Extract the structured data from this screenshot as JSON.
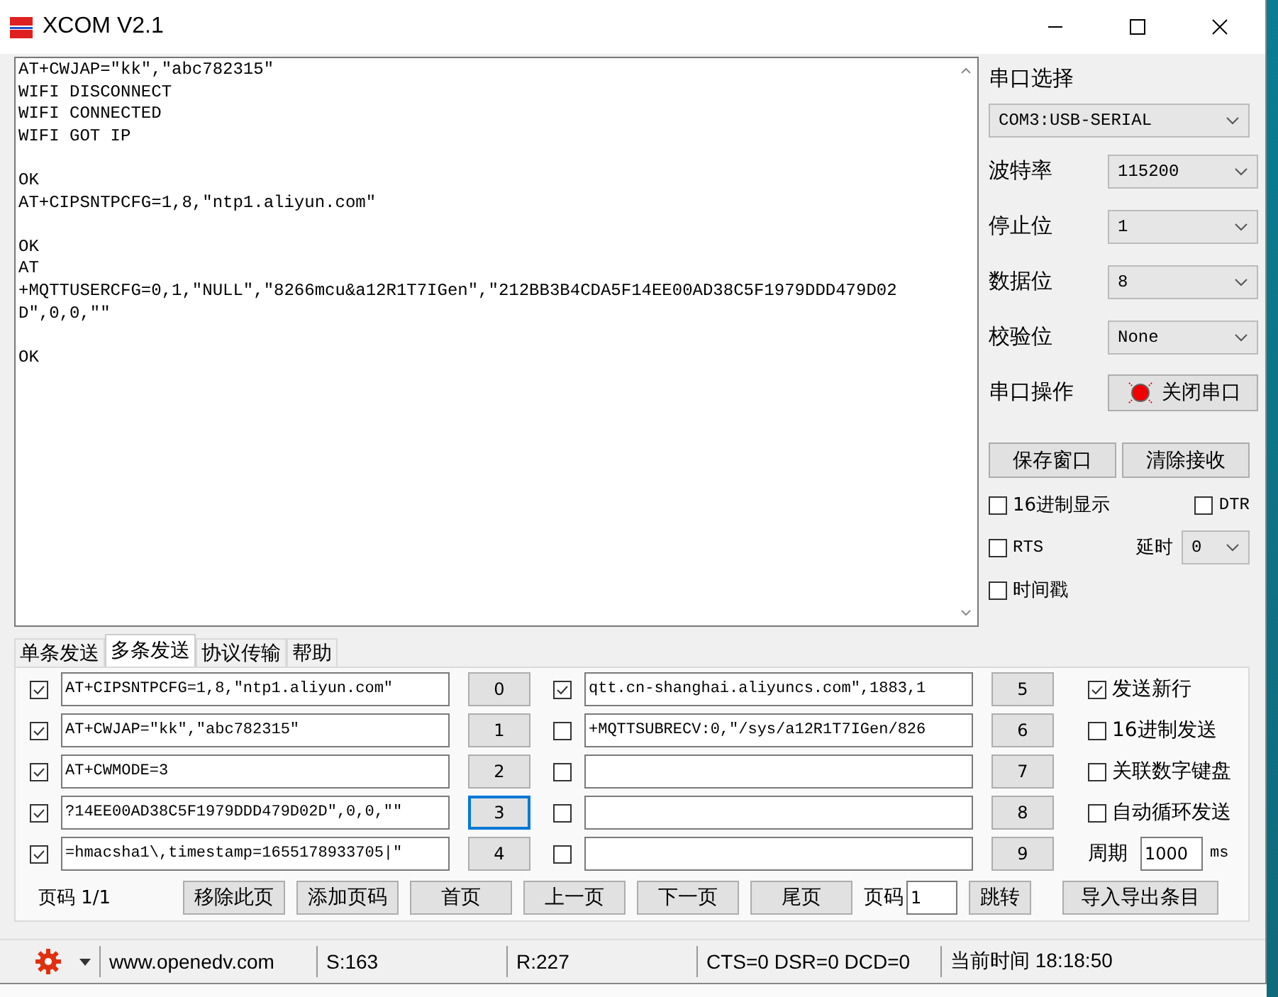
{
  "window": {
    "title": "XCOM V2.1"
  },
  "receive_blocks": [
    [
      "AT+CWJAP=\"kk\",\"abc782315\"",
      "WIFI DISCONNECT",
      "WIFI CONNECTED",
      "WIFI GOT IP"
    ],
    [
      "OK",
      "AT+CIPSNTPCFG=1,8,\"ntp1.aliyun.com\""
    ],
    [
      "OK",
      "AT",
      "+MQTTUSERCFG=0,1,\"NULL\",\"8266mcu&a12R1T7IGen\",\"212BB3B4CDA5F14EE00AD38C5F1979DDD479D02",
      "D\",0,0,\"\""
    ],
    [
      "OK"
    ]
  ],
  "settings": [
    {
      "label": "串口选择",
      "value": "COM3:USB-SERIAL",
      "kind": "stacked"
    },
    {
      "label": "波特率",
      "value": "115200",
      "kind": "inline"
    },
    {
      "label": "停止位",
      "value": "1",
      "kind": "inline"
    },
    {
      "label": "数据位",
      "value": "8",
      "kind": "inline"
    },
    {
      "label": "校验位",
      "value": "None",
      "kind": "inline"
    }
  ],
  "port_operation": {
    "label": "串口操作",
    "button": "关闭串口",
    "open": true
  },
  "panel_buttons": [
    "保存窗口",
    "清除接收"
  ],
  "options": {
    "hex_display": {
      "label": "16进制显示",
      "checked": false
    },
    "dtr": {
      "label": "DTR",
      "checked": false
    },
    "rts": {
      "label": "RTS",
      "checked": false
    },
    "delay": {
      "label": "延时",
      "value": "0"
    },
    "timestamp": {
      "label": "时间戳",
      "checked": false
    }
  },
  "tabs": [
    {
      "label": "单条发送",
      "selected": false
    },
    {
      "label": "多条发送",
      "selected": true
    },
    {
      "label": "协议传输",
      "selected": false
    },
    {
      "label": "帮助",
      "selected": false
    }
  ],
  "send_items": [
    {
      "checked": true,
      "value": "AT+CIPSNTPCFG=1,8,\"ntp1.aliyun.com\"",
      "number": "0",
      "focused": false
    },
    {
      "checked": true,
      "value": "AT+CWJAP=\"kk\",\"abc782315\"",
      "number": "1",
      "focused": false
    },
    {
      "checked": true,
      "value": "AT+CWMODE=3",
      "number": "2",
      "focused": false
    },
    {
      "checked": true,
      "value": "?14EE00AD38C5F1979DDD479D02D\",0,0,\"\"",
      "number": "3",
      "focused": true
    },
    {
      "checked": true,
      "value": "=hmacsha1\\,timestamp=1655178933705|\"",
      "number": "4",
      "focused": false
    },
    {
      "checked": true,
      "value": "qtt.cn-shanghai.aliyuncs.com\",1883,1",
      "number": "5",
      "focused": false
    },
    {
      "checked": false,
      "value": "+MQTTSUBRECV:0,\"/sys/a12R1T7IGen/826",
      "number": "6",
      "focused": false
    },
    {
      "checked": false,
      "value": "",
      "number": "7",
      "focused": false
    },
    {
      "checked": false,
      "value": "",
      "number": "8",
      "focused": false
    },
    {
      "checked": false,
      "value": "",
      "number": "9",
      "focused": false
    }
  ],
  "send_options": [
    {
      "label": "发送新行",
      "checked": true
    },
    {
      "label": "16进制发送",
      "checked": false
    },
    {
      "label": "关联数字键盘",
      "checked": false
    },
    {
      "label": "自动循环发送",
      "checked": false
    }
  ],
  "period": {
    "label": "周期",
    "value": "1000",
    "unit": "ms"
  },
  "pager": {
    "page_label": "页码 1/1",
    "buttons": [
      "移除此页",
      "添加页码",
      "首页",
      "上一页",
      "下一页",
      "尾页"
    ],
    "goto_label": "页码",
    "goto_value": "1",
    "goto_button": "跳转",
    "import_button": "导入导出条目"
  },
  "status_bar": {
    "website": "www.openedv.com",
    "sent": "S:163",
    "received": "R:227",
    "lines": "CTS=0 DSR=0 DCD=0",
    "time": "当前时间 18:18:50"
  }
}
